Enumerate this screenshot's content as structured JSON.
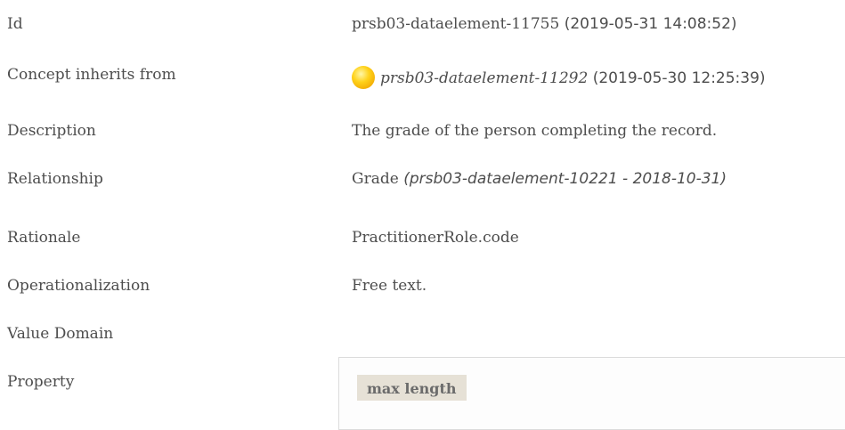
{
  "rows": {
    "id": {
      "label": "Id",
      "value": "prsb03-dataelement-11755",
      "timestamp": "(2019-05-31 14:08:52)"
    },
    "inherits": {
      "label": "Concept inherits from",
      "value": "prsb03-dataelement-11292",
      "timestamp": "(2019-05-30 12:25:39)",
      "status_icon": "status-orb-yellow",
      "status_color": "#ffcc00"
    },
    "description": {
      "label": "Description",
      "value": "The grade of the person completing the record."
    },
    "relationship": {
      "label": "Relationship",
      "value": "Grade",
      "ref": "(prsb03-dataelement-10221 - 2018-10-31)"
    },
    "rationale": {
      "label": "Rationale",
      "value": "PractitionerRole.code"
    },
    "operationalization": {
      "label": "Operationalization",
      "value": "Free text."
    },
    "value_domain": {
      "label": "Value Domain"
    },
    "property": {
      "label": "Property",
      "tag": "max length"
    }
  }
}
